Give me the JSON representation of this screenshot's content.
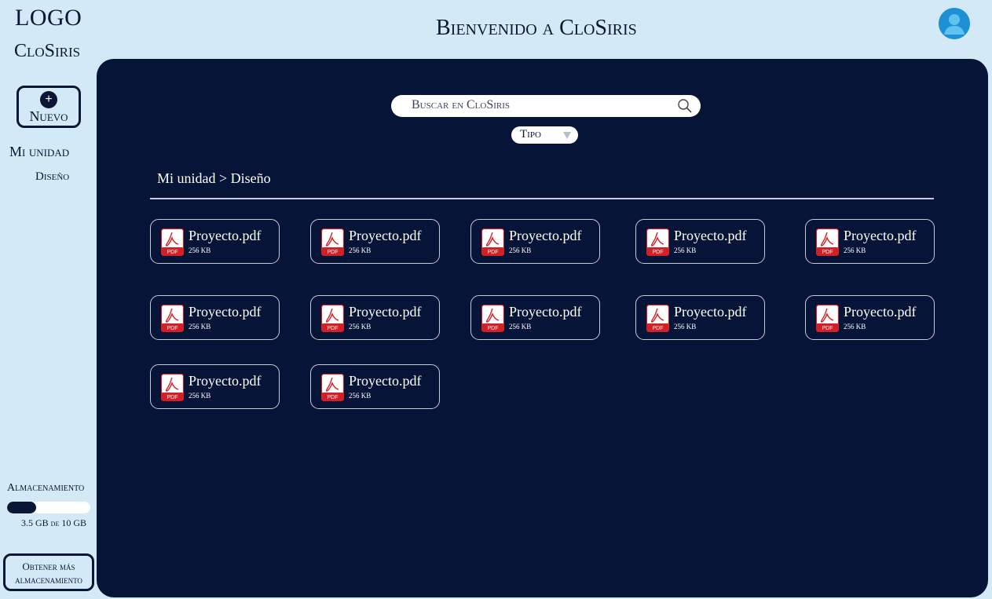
{
  "sidebar": {
    "logo": "LOGO",
    "brand": "CloSiris",
    "new_button": {
      "icon": "plus-icon",
      "label": "Nuevo"
    },
    "nav": [
      {
        "label": "Mi unidad"
      },
      {
        "label": "Diseño"
      }
    ],
    "storage": {
      "title": "Almacenamiento",
      "used_fraction": 0.35,
      "text": "3.5 GB de 10 GB",
      "more_button": "Obtener más almacenamiento"
    }
  },
  "header": {
    "title": "Bienvenido a CloSiris",
    "avatar_icon": "user-avatar-icon"
  },
  "main": {
    "search": {
      "placeholder": "Buscar en CloSiris",
      "icon": "search-icon"
    },
    "type_filter": {
      "label": "Tipo",
      "icon": "chevron-down-icon"
    },
    "breadcrumb": [
      "Mi unidad",
      "Diseño"
    ],
    "breadcrumb_separator": ">",
    "files": [
      {
        "name": "Proyecto.pdf",
        "size": "256 KB",
        "icon": "pdf-icon"
      },
      {
        "name": "Proyecto.pdf",
        "size": "256 KB",
        "icon": "pdf-icon"
      },
      {
        "name": "Proyecto.pdf",
        "size": "256 KB",
        "icon": "pdf-icon"
      },
      {
        "name": "Proyecto.pdf",
        "size": "256 KB",
        "icon": "pdf-icon"
      },
      {
        "name": "Proyecto.pdf",
        "size": "256 KB",
        "icon": "pdf-icon"
      },
      {
        "name": "Proyecto.pdf",
        "size": "256 KB",
        "icon": "pdf-icon"
      },
      {
        "name": "Proyecto.pdf",
        "size": "256 KB",
        "icon": "pdf-icon"
      },
      {
        "name": "Proyecto.pdf",
        "size": "256 KB",
        "icon": "pdf-icon"
      },
      {
        "name": "Proyecto.pdf",
        "size": "256 KB",
        "icon": "pdf-icon"
      },
      {
        "name": "Proyecto.pdf",
        "size": "256 KB",
        "icon": "pdf-icon"
      },
      {
        "name": "Proyecto.pdf",
        "size": "256 KB",
        "icon": "pdf-icon"
      },
      {
        "name": "Proyecto.pdf",
        "size": "256 KB",
        "icon": "pdf-icon"
      }
    ]
  },
  "colors": {
    "background": "#d3eaf6",
    "panel": "#061437",
    "accent": "#0b1634",
    "pdf_red": "#d32027",
    "avatar": "#1e90d6"
  }
}
